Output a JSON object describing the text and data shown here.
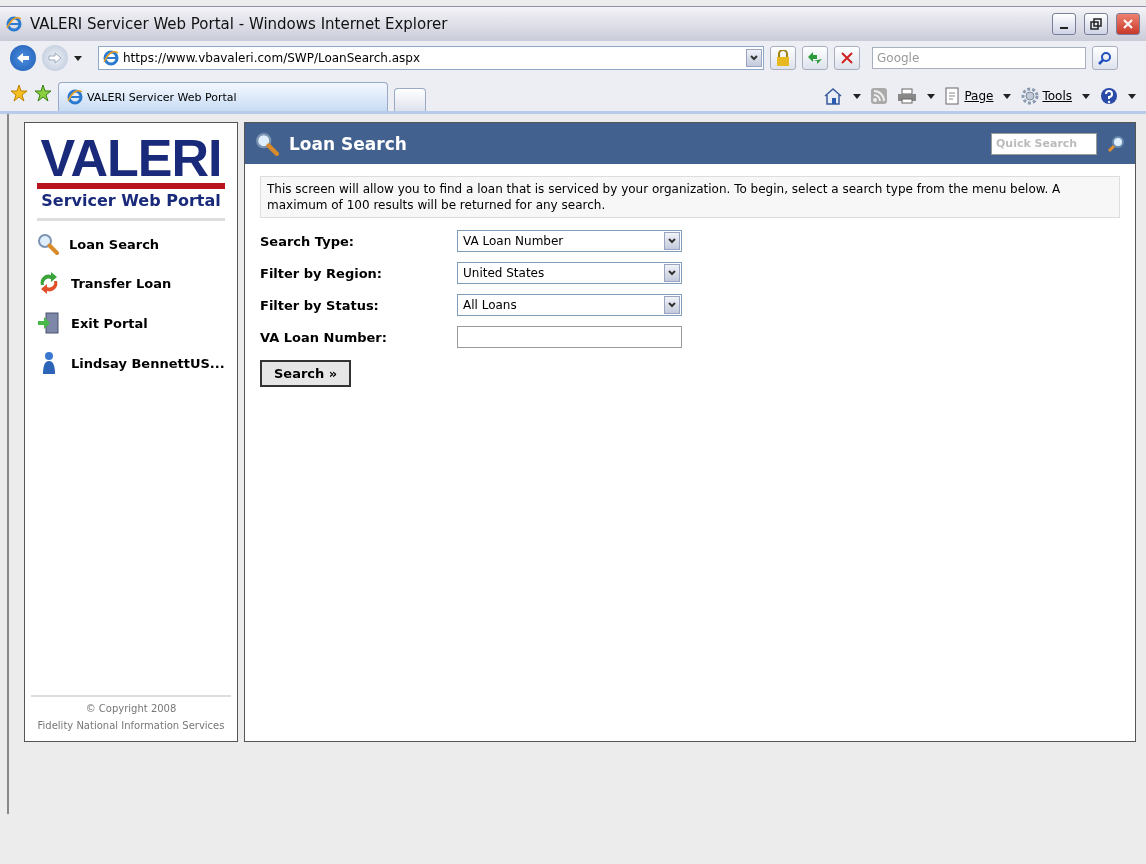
{
  "window": {
    "title": "VALERI Servicer Web Portal - Windows Internet Explorer"
  },
  "browser": {
    "address": "https://www.vbavaleri.com/SWP/LoanSearch.aspx",
    "search_placeholder": "Google",
    "tabs": [
      {
        "label": "VALERI Servicer Web Portal",
        "selected": true
      }
    ],
    "commands": [
      {
        "label": "Page",
        "kind": "page"
      },
      {
        "label": "Tools",
        "kind": "tools"
      }
    ]
  },
  "sidebar": {
    "logo": "VALERI",
    "logo_subtitle": "Servicer Web Portal",
    "items": [
      {
        "label": "Loan Search",
        "kind": "search"
      },
      {
        "label": "Transfer Loan",
        "kind": "transfer"
      },
      {
        "label": "Exit Portal",
        "kind": "exit"
      },
      {
        "label": "Lindsay BennettUS...",
        "kind": "user"
      }
    ],
    "footer": [
      "© Copyright 2008",
      "Fidelity National Information Services"
    ]
  },
  "main": {
    "title": "Loan Search",
    "quick_search_placeholder": "Quick Search",
    "intro": "This screen will allow you to find a loan that is serviced by your organization. To begin, select a search type from the menu below. A maximum of 100 results will be returned for any search.",
    "fields": [
      {
        "label": "Search Type:",
        "kind": "select",
        "value": "VA Loan Number"
      },
      {
        "label": "Filter by Region:",
        "kind": "select",
        "value": "United States"
      },
      {
        "label": "Filter by Status:",
        "kind": "select",
        "value": "All Loans"
      },
      {
        "label": "VA Loan Number:",
        "kind": "text"
      }
    ],
    "button": "Search »"
  }
}
